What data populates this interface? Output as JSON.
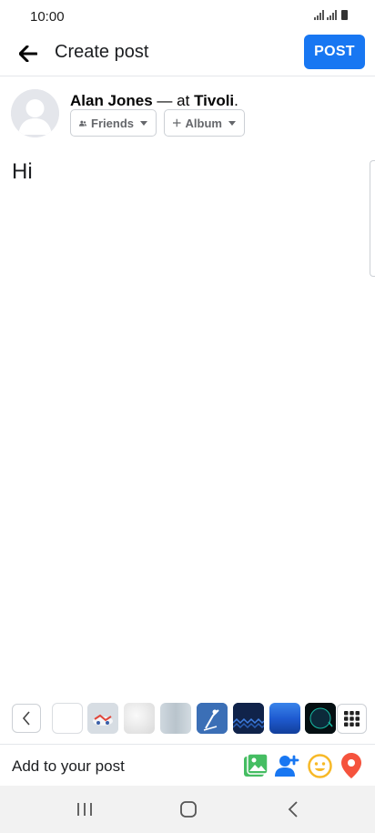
{
  "status_bar": {
    "time": "10:00"
  },
  "header": {
    "title": "Create post",
    "post_label": "POST"
  },
  "author": {
    "name": "Alan Jones",
    "separator": " — at ",
    "place": "Tivoli",
    "suffix": ".",
    "audience_label": "Friends",
    "album_label": "Album"
  },
  "composer": {
    "text": "Hi"
  },
  "background_strip": {
    "swatches": [
      {
        "name": "plain-white",
        "color": "#ffffff"
      },
      {
        "name": "illustration-people",
        "color": "#d7dde3"
      },
      {
        "name": "white-texture",
        "color": "#e6e6e6"
      },
      {
        "name": "light-blue-gray",
        "color": "#c5d0d8"
      },
      {
        "name": "blue-skater",
        "color": "#3b6fb6"
      },
      {
        "name": "dark-navy-waves",
        "color": "#10234a"
      },
      {
        "name": "blue-ocean",
        "color": "#1f5bd1"
      },
      {
        "name": "black-circle",
        "color": "#050f12"
      }
    ]
  },
  "add_to_post": {
    "label": "Add to your post",
    "icons": [
      "photo-icon",
      "tag-people-icon",
      "feeling-icon",
      "location-icon"
    ]
  },
  "colors": {
    "accent": "#1877f2",
    "photo_green": "#45bd62",
    "tag_blue": "#1877f2",
    "feeling_yellow": "#f7b928",
    "location_red": "#f5533d"
  }
}
